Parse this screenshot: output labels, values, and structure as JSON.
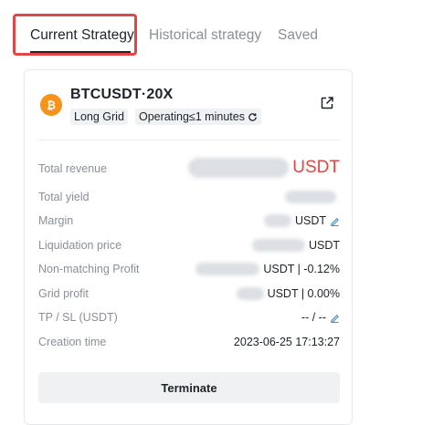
{
  "tabs": [
    {
      "label": "Current Strategy"
    },
    {
      "label": "Historical strategy"
    },
    {
      "label": "Saved"
    }
  ],
  "strategy": {
    "pair": "BTCUSDT·20X",
    "grid_type": "Long Grid",
    "status": "Operating≤1 minutes",
    "icons": {
      "coin": "bitcoin-icon",
      "share": "external-link-icon",
      "edit": "pencil-icon",
      "refresh": "refresh-icon"
    }
  },
  "rows": [
    {
      "label": "Total revenue",
      "value": "USDT"
    },
    {
      "label": "Total yield",
      "value": ""
    },
    {
      "label": "Margin",
      "value": "USDT"
    },
    {
      "label": "Liquidation price",
      "value": "USDT"
    },
    {
      "label": "Non-matching Profit",
      "value": "USDT | -0.12%"
    },
    {
      "label": "Grid profit",
      "value": "USDT | 0.00%"
    },
    {
      "label": "TP / SL (USDT)",
      "value": "-- / --"
    },
    {
      "label": "Creation time",
      "value": "2023-06-25 17:13:27"
    }
  ],
  "terminate_label": "Terminate",
  "colors": {
    "accent_red": "#e24545",
    "bitcoin_orange": "#f7931a",
    "highlight_border": "#e04848"
  }
}
